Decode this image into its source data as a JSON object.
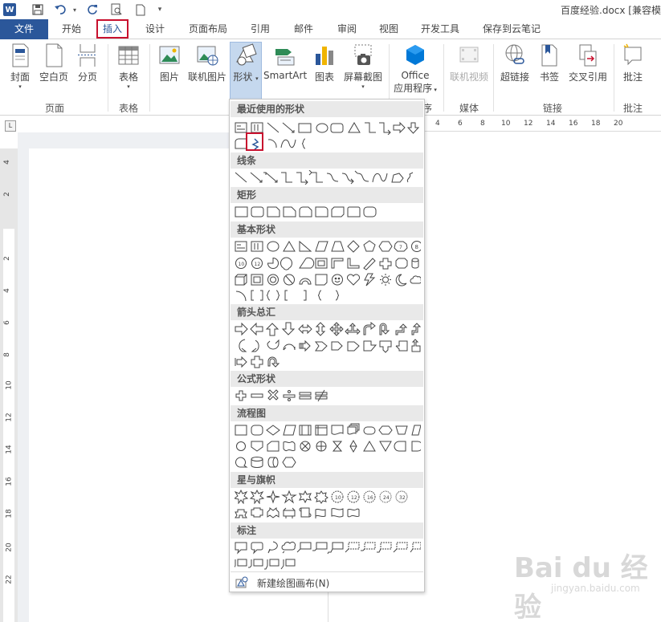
{
  "app": {
    "word_icon": "W",
    "doc_title": "百度经验.docx [兼容模"
  },
  "tabs": [
    {
      "label": "文件"
    },
    {
      "label": "开始"
    },
    {
      "label": "插入"
    },
    {
      "label": "设计"
    },
    {
      "label": "页面布局"
    },
    {
      "label": "引用"
    },
    {
      "label": "邮件"
    },
    {
      "label": "审阅"
    },
    {
      "label": "视图"
    },
    {
      "label": "开发工具"
    },
    {
      "label": "保存到云笔记"
    }
  ],
  "ribbon": {
    "buttons": {
      "cover": "封面",
      "blank": "空白页",
      "pagebreak": "分页",
      "table": "表格",
      "picture": "图片",
      "online_picture": "联机图片",
      "shapes": "形状",
      "smartart": "SmartArt",
      "chart": "图表",
      "screenshot": "屏幕截图",
      "office_apps_1": "Office",
      "office_apps_2": "应用程序",
      "online_video": "联机视频",
      "hyperlink": "超链接",
      "bookmark": "书签",
      "crossref": "交叉引用",
      "comment": "批注"
    },
    "groups": {
      "pages": "页面",
      "tables": "表格",
      "apps_tail": "序",
      "media": "媒体",
      "links": "链接",
      "comments": "批注"
    }
  },
  "ruler": {
    "h_ticks": [
      "4",
      "6",
      "8",
      "10",
      "12",
      "14",
      "16",
      "18",
      "20"
    ],
    "v_ticks": [
      "4",
      "2",
      "2",
      "4",
      "6",
      "8",
      "10",
      "12",
      "14",
      "16",
      "18",
      "20",
      "22"
    ]
  },
  "shapes_menu": {
    "sections": {
      "recent": "最近使用的形状",
      "lines": "线条",
      "rect": "矩形",
      "basic": "基本形状",
      "arrows": "箭头总汇",
      "equation": "公式形状",
      "flowchart": "流程图",
      "stars": "星与旗帜",
      "callouts": "标注"
    },
    "new_canvas": "新建绘图画布(N)"
  },
  "watermark": {
    "brand": "Bai du 经验",
    "url": "jingyan.baidu.com"
  },
  "colors": {
    "accent": "#2b579a",
    "highlight_red": "#c8102e",
    "shapes_active": "#c5d8ee"
  }
}
